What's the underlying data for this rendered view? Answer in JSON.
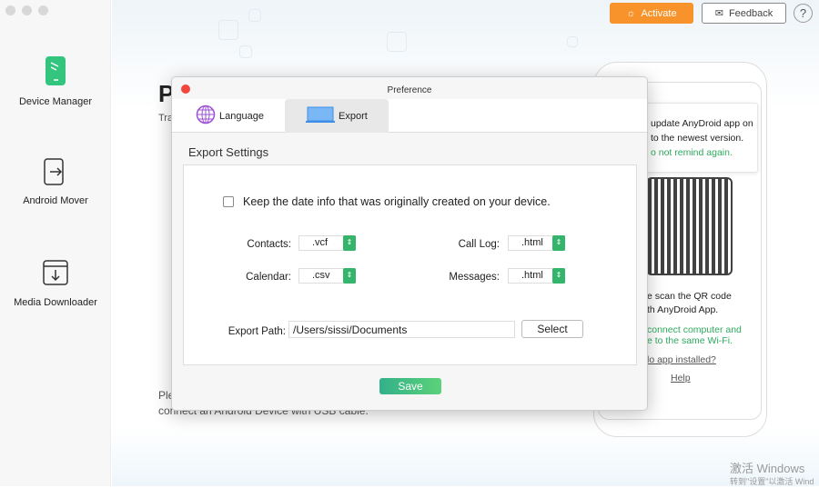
{
  "sidebar": {
    "items": [
      {
        "label": "Device Manager"
      },
      {
        "label": "Android Mover"
      },
      {
        "label": "Media Downloader"
      }
    ]
  },
  "header": {
    "activate": "Activate",
    "feedback": "Feedback",
    "help": "?"
  },
  "background": {
    "title_partial": "P",
    "subtitle_partial": "Tra",
    "hint_line1_partial": "Ple",
    "hint_line2": "connect an Android Device with USB cable."
  },
  "phone_panel": {
    "tooltip_line1": "update AnyDroid app on",
    "tooltip_line2": "to the newest version.",
    "tooltip_link": "o not remind again.",
    "scan_line1": "e scan the QR code",
    "scan_line2": "th AnyDroid App.",
    "wifi_line1": "connect computer and",
    "wifi_line2": "e to the same Wi-Fi.",
    "no_app": "lo app installed?",
    "help": "Help"
  },
  "dialog": {
    "title": "Preference",
    "tabs": [
      {
        "label": "Language"
      },
      {
        "label": "Export"
      }
    ],
    "section": "Export Settings",
    "keep_date": "Keep the date info that was originally created on your device.",
    "keep_date_checked": false,
    "contacts_label": "Contacts:",
    "contacts_value": ".vcf",
    "calendar_label": "Calendar:",
    "calendar_value": ".csv",
    "calllog_label": "Call Log:",
    "calllog_value": ".html",
    "messages_label": "Messages:",
    "messages_value": ".html",
    "path_label": "Export Path:",
    "path_value": "/Users/sissi/Documents",
    "select": "Select",
    "save": "Save"
  },
  "watermark": {
    "line1": "激活 Windows",
    "line2": "转到\"设置\"以激活 Wind"
  }
}
